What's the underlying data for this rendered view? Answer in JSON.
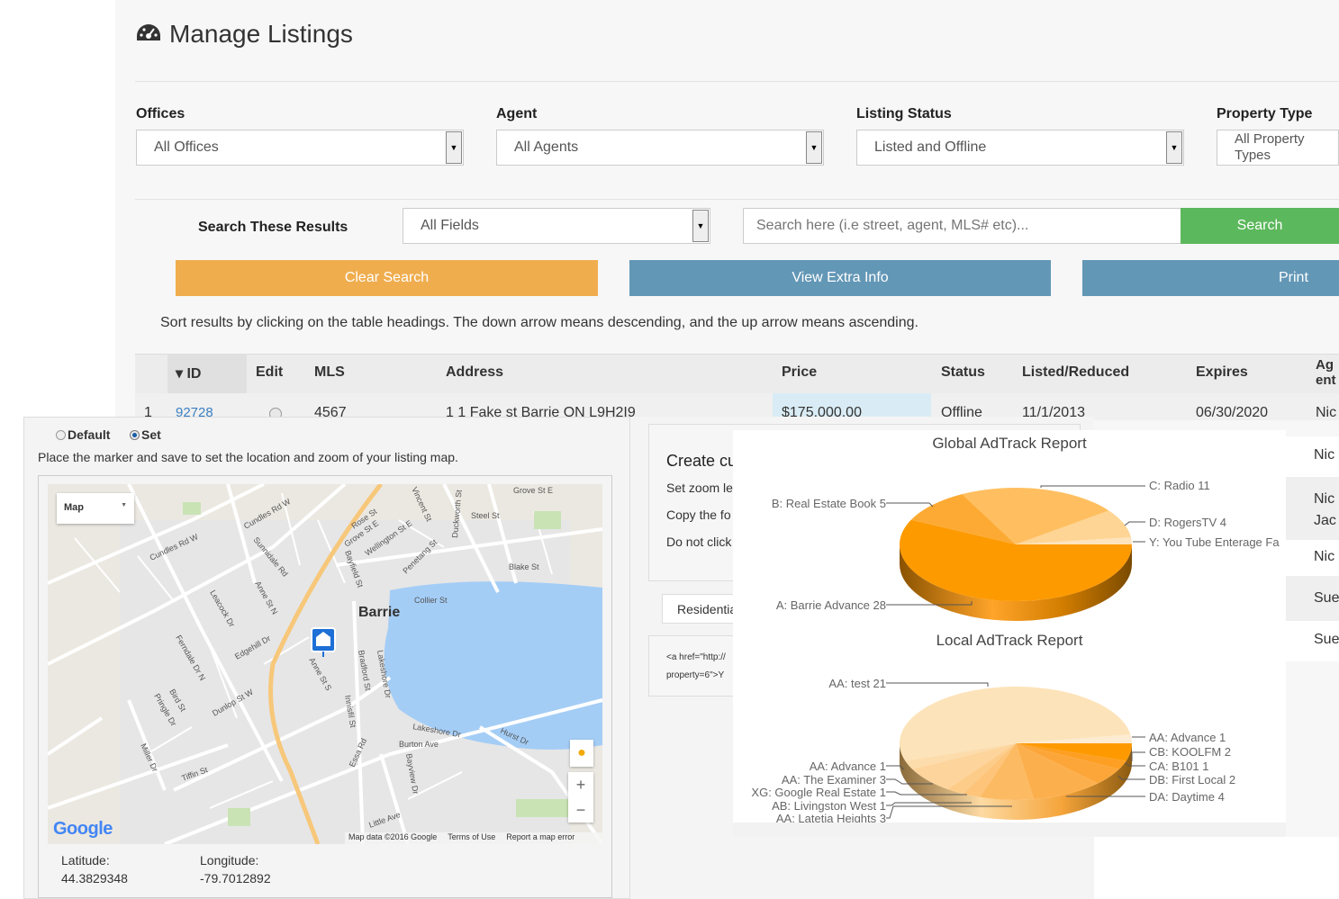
{
  "header": {
    "title": "Manage Listings",
    "icon": "dashboard-icon"
  },
  "filters": [
    {
      "label": "Offices",
      "value": "All Offices"
    },
    {
      "label": "Agent",
      "value": "All Agents"
    },
    {
      "label": "Listing Status",
      "value": "Listed and Offline"
    },
    {
      "label": "Property Type",
      "value": "All Property Types"
    }
  ],
  "search": {
    "label": "Search These Results",
    "field": "All Fields",
    "placeholder": "Search here (i.e street, agent, MLS# etc)...",
    "button": "Search"
  },
  "actions": {
    "clear": "Clear Search",
    "extra": "View Extra Info",
    "print": "Print"
  },
  "colors": {
    "orange": "#f0ad4e",
    "blue": "#6397b6",
    "green": "#5cb85c"
  },
  "sort_hint": "Sort results by clicking on the table headings. The down arrow means descending, and the up arrow means ascending.",
  "table": {
    "headers": [
      "▾ ID",
      "Edit",
      "MLS",
      "Address",
      "Price",
      "Status",
      "Listed/Reduced",
      "Expires",
      "Agent"
    ],
    "row": {
      "num": "1",
      "id": "92728",
      "mls": "4567",
      "address": "1 1 Fake st   Barrie  ON  L9H2I9",
      "price": "$175,000.00",
      "status": "Offline",
      "listed": "11/1/2013",
      "expires": "06/30/2020",
      "agent": "Nic"
    },
    "agent_col": [
      "Nic",
      "Nic",
      "Jac",
      "Nic",
      "Sue",
      "Sue"
    ]
  },
  "map_panel": {
    "radio_default": "Default",
    "radio_set": "Set",
    "selected": "Set",
    "instructions": "Place the marker and save to set the location and zoom of your listing map.",
    "map_type": "Map",
    "attribution": "Map data ©2016 Google",
    "terms": "Terms of Use",
    "report": "Report a map error",
    "google": "Google",
    "city": "Barrie",
    "streets": [
      "Grove St E",
      "Steel St",
      "Blake St",
      "Collier St",
      "Wellington St E",
      "Penetang St",
      "Grove St E",
      "Rose St",
      "Sunnidale Rd",
      "Cundles Rd W",
      "Cundles Rd W",
      "Anne St N",
      "Leacock Dr",
      "Ferndale Dr N",
      "Edgehill Dr",
      "Dunlop St W",
      "Anne St S",
      "Bradford St",
      "Innisfil St",
      "Lakeshore Dr",
      "Lakeshore Dr",
      "Burton Ave",
      "Hurst Dr",
      "Essa Rd",
      "Bayview Dr",
      "Tiffin St",
      "Miller Dr",
      "Pringle Dr",
      "Bird St",
      "Little Ave",
      "Duckworth St",
      "Vincent St",
      "Bayfield St"
    ],
    "latitude_label": "Latitude:",
    "latitude": "44.3829348",
    "longitude_label": "Longitude:",
    "longitude": "-79.7012892"
  },
  "middle": {
    "heading": "Create cu",
    "lines": [
      "Set zoom le",
      "Copy the fo",
      "Do not click"
    ],
    "tab": "Residentia",
    "code": [
      "<a href=\"http://",
      "property=6\">Y"
    ]
  },
  "chart_data": [
    {
      "type": "pie",
      "title": "Global AdTrack Report",
      "3d": true,
      "slices": [
        {
          "label": "Y: You Tube Enterage Fa",
          "value": null,
          "color": "#fde4bd"
        },
        {
          "label": "D: RogersTV 4",
          "value": 4,
          "color": "#ffd595"
        },
        {
          "label": "C: Radio 11",
          "value": 11,
          "color": "#ffbf60"
        },
        {
          "label": "B: Real Estate Book 5",
          "value": 5,
          "color": "#fcaa33"
        },
        {
          "label": "A: Barrie Advance 28",
          "value": 28,
          "color": "#fd9a00"
        }
      ]
    },
    {
      "type": "pie",
      "title": "Local AdTrack Report",
      "3d": true,
      "slices": [
        {
          "label": "AA: Advance 1",
          "value": 1,
          "color": "#fdebd2"
        },
        {
          "label": "AA: test 21",
          "value": 21,
          "color": "#fde3b9"
        },
        {
          "label": "AA: Advance 1",
          "value": 1,
          "color": "#fddcac"
        },
        {
          "label": "AA: The Examiner 3",
          "value": 3,
          "color": "#fdd59c"
        },
        {
          "label": "XG: Google Real Estate 1",
          "value": 1,
          "color": "#fdcc88"
        },
        {
          "label": "AB: Livingston West 1",
          "value": 1,
          "color": "#fdc47a"
        },
        {
          "label": "AA: Latetia Heights 3",
          "value": 3,
          "color": "#fcbb63"
        },
        {
          "label": "DA: Daytime 4",
          "value": 4,
          "color": "#fcb04d"
        },
        {
          "label": "DB: First Local 2",
          "value": 2,
          "color": "#fca63a"
        },
        {
          "label": "CA: B101 1",
          "value": 1,
          "color": "#fd9f22"
        },
        {
          "label": "CB: KOOLFM 2",
          "value": 2,
          "color": "#fe9a00"
        }
      ]
    }
  ]
}
